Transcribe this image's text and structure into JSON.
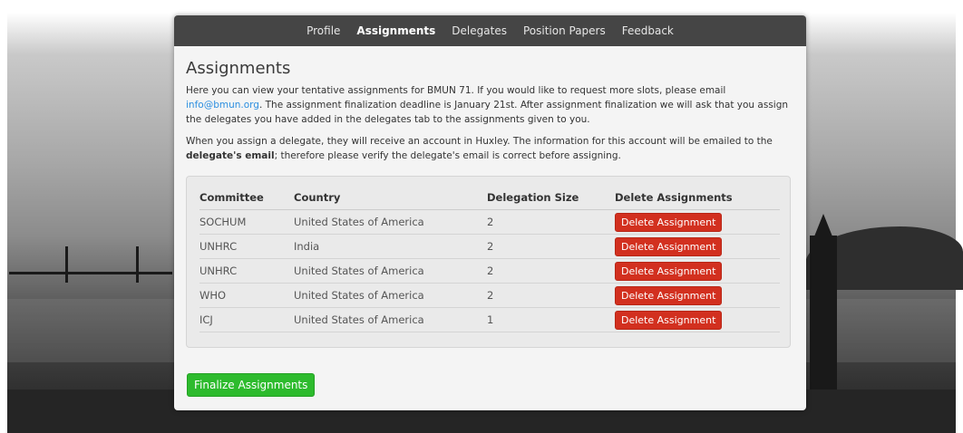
{
  "nav": {
    "items": [
      "Profile",
      "Assignments",
      "Delegates",
      "Position Papers",
      "Feedback"
    ],
    "active": "Assignments"
  },
  "page": {
    "title": "Assignments",
    "intro_1": "Here you can view your tentative assignments for BMUN 71. If you would like to request more slots, please email ",
    "email": "info@bmun.org",
    "intro_2": ". The assignment finalization deadline is January 21st. After assignment finalization we will ask that you assign the delegates you have added in the delegates tab to the assignments given to you.",
    "para2_1": "When you assign a delegate, they will receive an account in Huxley. The information for this account will be emailed to the ",
    "para2_bold": "delegate's email",
    "para2_2": "; therefore please verify the delegate's email is correct before assigning."
  },
  "table": {
    "headers": [
      "Committee",
      "Country",
      "Delegation Size",
      "Delete Assignments"
    ],
    "rows": [
      {
        "committee": "SOCHUM",
        "country": "United States of America",
        "size": "2"
      },
      {
        "committee": "UNHRC",
        "country": "India",
        "size": "2"
      },
      {
        "committee": "UNHRC",
        "country": "United States of America",
        "size": "2"
      },
      {
        "committee": "WHO",
        "country": "United States of America",
        "size": "2"
      },
      {
        "committee": "ICJ",
        "country": "United States of America",
        "size": "1"
      }
    ],
    "delete_label": "Delete Assignment"
  },
  "finalize_label": "Finalize Assignments",
  "colors": {
    "navbar": "#454545",
    "delete": "#d2301f",
    "finalize": "#2dbb2d",
    "link": "#2d8fe0"
  }
}
